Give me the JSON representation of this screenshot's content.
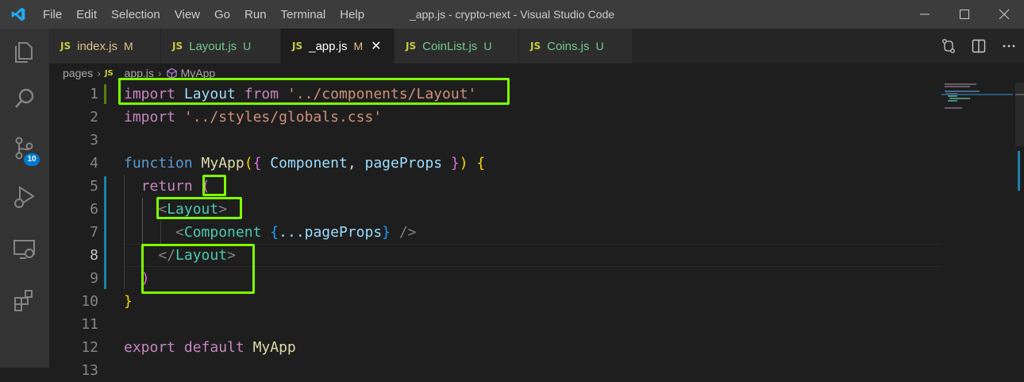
{
  "window": {
    "title": "_app.js - crypto-next - Visual Studio Code",
    "menu": [
      "File",
      "Edit",
      "Selection",
      "View",
      "Go",
      "Run",
      "Terminal",
      "Help"
    ],
    "controls": [
      "minimize",
      "maximize",
      "close"
    ]
  },
  "activity_bar": {
    "items": [
      "explorer",
      "search",
      "source-control",
      "run-and-debug",
      "remote-explorer",
      "extensions"
    ],
    "source_control_badge": "10"
  },
  "tabs": [
    {
      "icon": "JS",
      "name": "index.js",
      "status": "M",
      "active": false
    },
    {
      "icon": "JS",
      "name": "Layout.js",
      "status": "U",
      "active": false
    },
    {
      "icon": "JS",
      "name": "_app.js",
      "status": "M",
      "active": true
    },
    {
      "icon": "JS",
      "name": "CoinList.js",
      "status": "U",
      "active": false
    },
    {
      "icon": "JS",
      "name": "Coins.js",
      "status": "U",
      "active": false
    }
  ],
  "breadcrumb": {
    "folder": "pages",
    "file_icon": "JS",
    "file": "_app.js",
    "symbol": "MyApp"
  },
  "editor": {
    "line_numbers": [
      "1",
      "2",
      "3",
      "4",
      "5",
      "6",
      "7",
      "8",
      "9",
      "10",
      "11",
      "12",
      "13"
    ],
    "current_line": 8,
    "lines": {
      "l1": {
        "kw": "import",
        "id": "Layout",
        "from": "from",
        "str": "'../components/Layout'"
      },
      "l2": {
        "kw": "import",
        "str": "'../styles/globals.css'"
      },
      "l4": {
        "kw": "function",
        "fn": "MyApp",
        "p1": "Component",
        "p2": "pageProps"
      },
      "l5": {
        "kw": "return"
      },
      "l6": {
        "tag": "Layout"
      },
      "l7": {
        "tag": "Component",
        "spread": "...pageProps"
      },
      "l8": {
        "tag": "Layout"
      },
      "l12": {
        "kw1": "export",
        "kw2": "default",
        "id": "MyApp"
      }
    }
  },
  "colors": {
    "highlight_box": "#7fff00",
    "git_added": "#587c0c",
    "git_modified": "#1b81a8"
  }
}
